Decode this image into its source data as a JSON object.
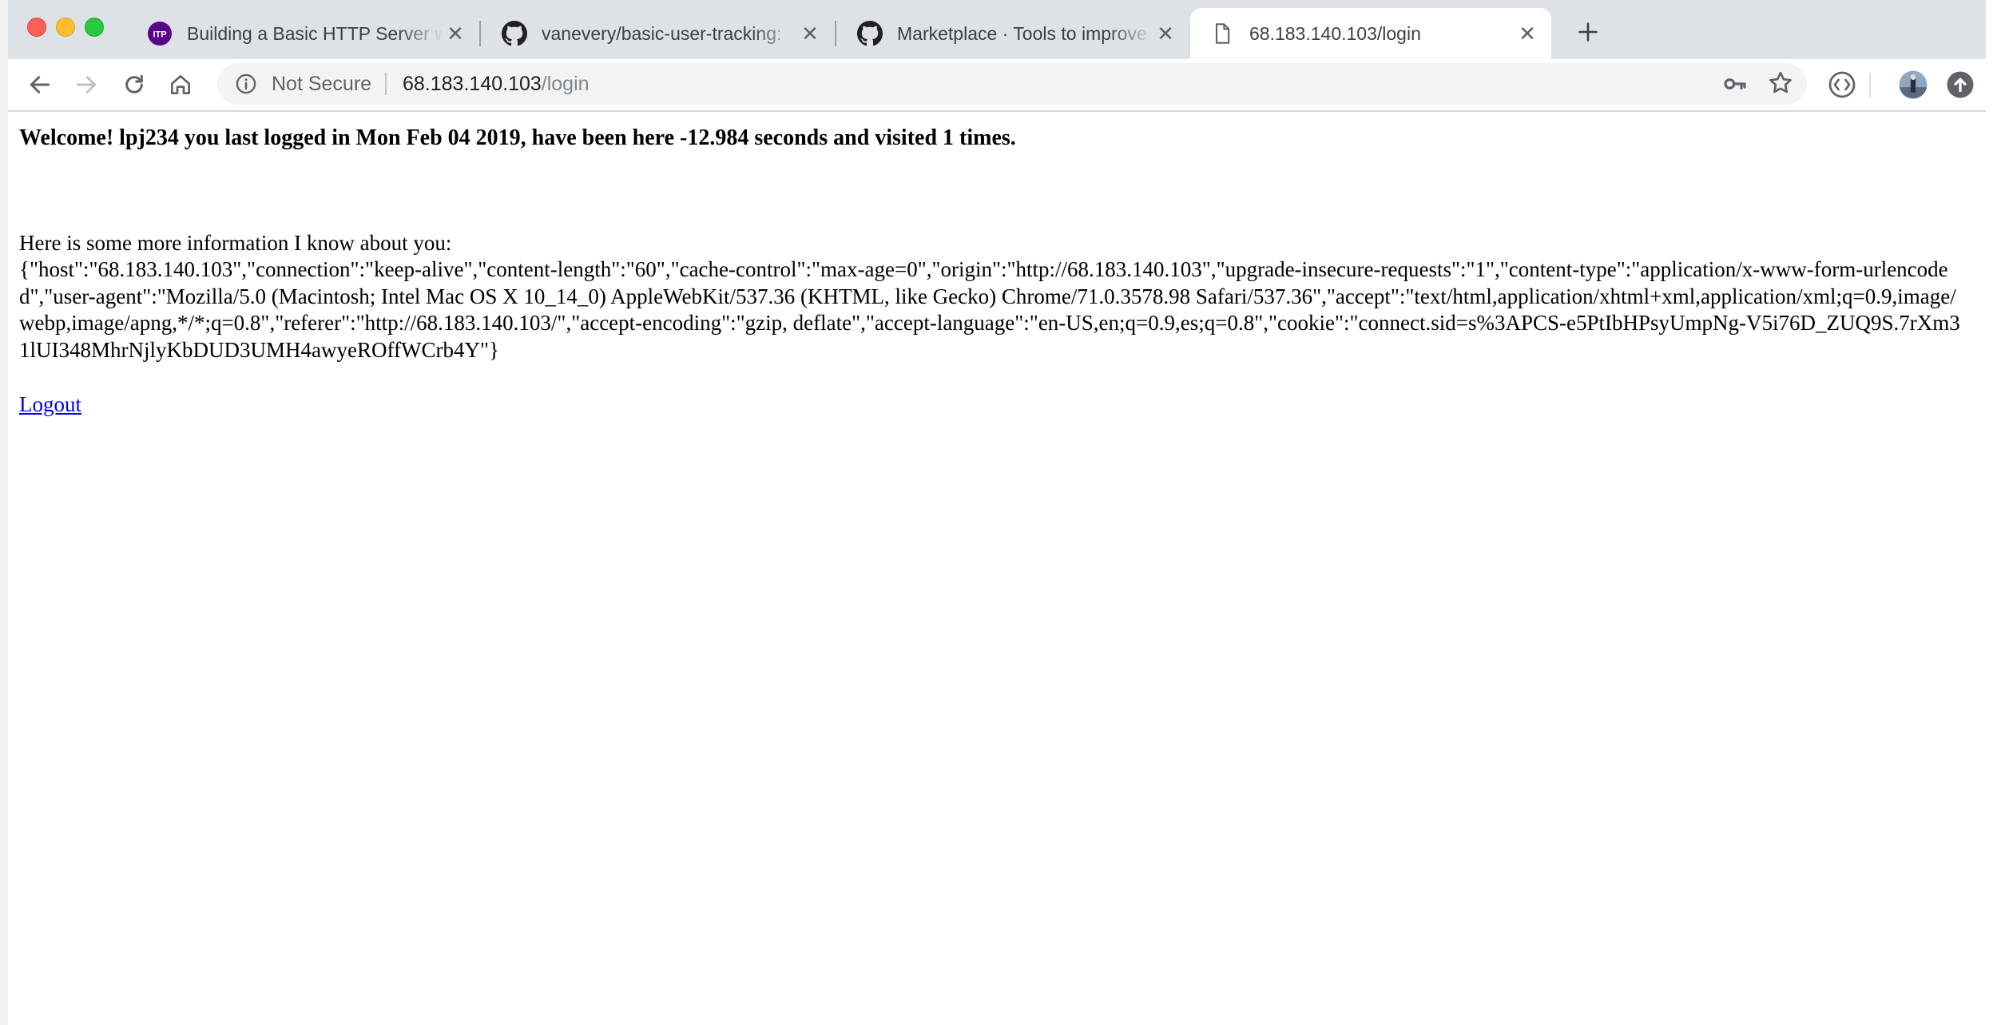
{
  "browser": {
    "tabs": [
      {
        "title": "Building a Basic HTTP Server w",
        "icon": "itp-favicon",
        "active": false
      },
      {
        "title": "vanevery/basic-user-tracking:",
        "icon": "github-icon",
        "active": false
      },
      {
        "title": "Marketplace · Tools to improve",
        "icon": "github-icon",
        "active": false
      },
      {
        "title": "68.183.140.103/login",
        "icon": "document-icon",
        "active": true
      }
    ],
    "favicon_itp_text": "ITP",
    "close_glyph": "✕",
    "omnibox": {
      "security_label": "Not Secure",
      "host": "68.183.140.103",
      "path": "/login"
    }
  },
  "page": {
    "welcome": "Welcome! lpj234 you last logged in Mon Feb 04 2019, have been here -12.984 seconds and visited 1 times.",
    "info_intro": "Here is some more information I know about you:",
    "headers_json": "{\"host\":\"68.183.140.103\",\"connection\":\"keep-alive\",\"content-length\":\"60\",\"cache-control\":\"max-age=0\",\"origin\":\"http://68.183.140.103\",\"upgrade-insecure-requests\":\"1\",\"content-type\":\"application/x-www-form-urlencoded\",\"user-agent\":\"Mozilla/5.0 (Macintosh; Intel Mac OS X 10_14_0) AppleWebKit/537.36 (KHTML, like Gecko) Chrome/71.0.3578.98 Safari/537.36\",\"accept\":\"text/html,application/xhtml+xml,application/xml;q=0.9,image/webp,image/apng,*/*;q=0.8\",\"referer\":\"http://68.183.140.103/\",\"accept-encoding\":\"gzip, deflate\",\"accept-language\":\"en-US,en;q=0.9,es;q=0.8\",\"cookie\":\"connect.sid=s%3APCS-e5PtIbHPsyUmpNg-V5i76D_ZUQ9S.7rXm31lUI348MhrNjlyKbDUD3UMH4awyeROffWCrb4Y\"}",
    "logout_label": "Logout"
  },
  "colors": {
    "tabstrip": "#dee1e6",
    "omnibox": "#f1f3f4",
    "link": "#0000ee"
  }
}
